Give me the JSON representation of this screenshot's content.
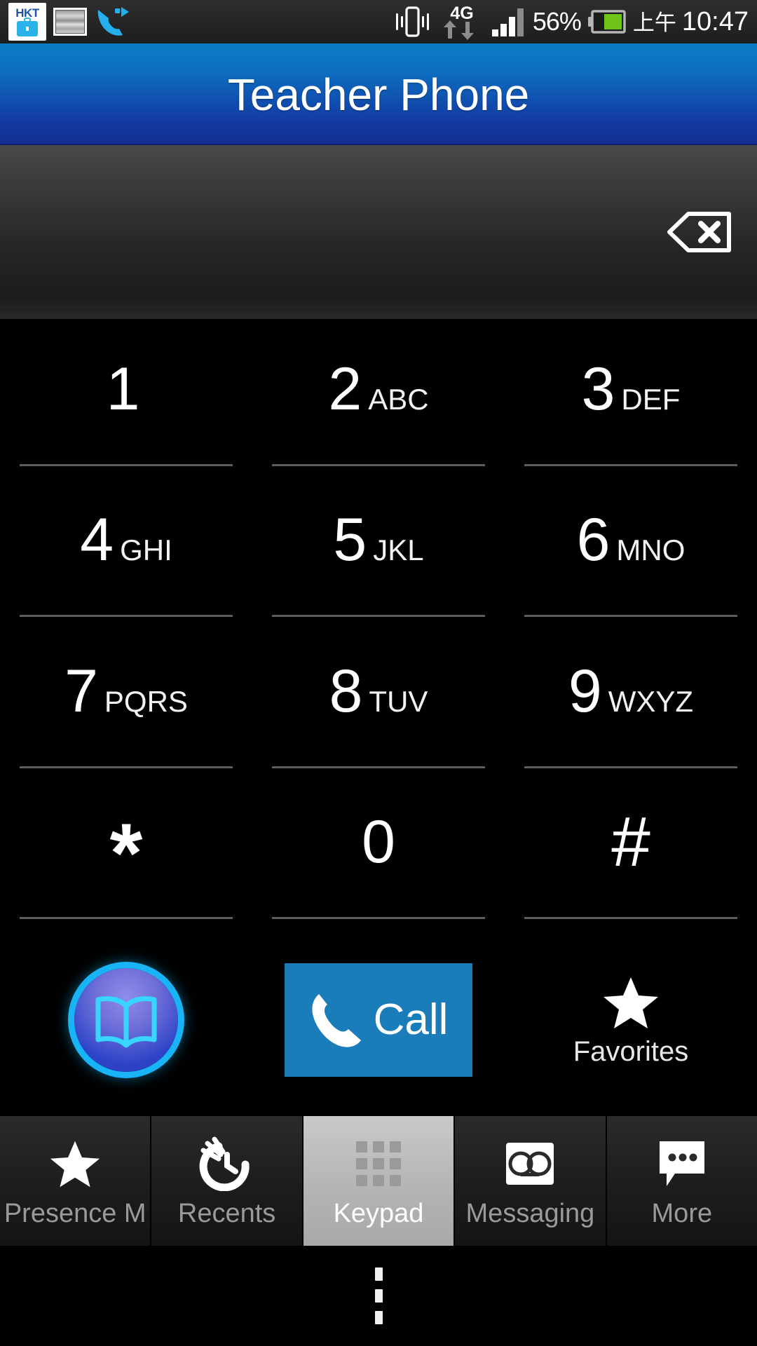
{
  "status_bar": {
    "left_icons": [
      {
        "name": "hkt-briefcase-icon",
        "label": "HKT"
      },
      {
        "name": "picture-icon",
        "label": ""
      },
      {
        "name": "call-forward-icon",
        "label": ""
      }
    ],
    "right_icons": [
      {
        "name": "vibrate-icon",
        "label": ""
      },
      {
        "name": "network-4g-icon",
        "label": "4G"
      },
      {
        "name": "signal-bars-icon",
        "label": ""
      }
    ],
    "battery_percent": "56%",
    "battery_level": 56,
    "clock_ampm": "上午",
    "clock_time": "10:47"
  },
  "header": {
    "title": "Teacher Phone"
  },
  "display": {
    "number": "",
    "placeholder": "",
    "backspace_icon": "backspace-icon"
  },
  "keypad": {
    "keys": [
      {
        "digit": "1",
        "letters": ""
      },
      {
        "digit": "2",
        "letters": "ABC"
      },
      {
        "digit": "3",
        "letters": "DEF"
      },
      {
        "digit": "4",
        "letters": "GHI"
      },
      {
        "digit": "5",
        "letters": "JKL"
      },
      {
        "digit": "6",
        "letters": "MNO"
      },
      {
        "digit": "7",
        "letters": "PQRS"
      },
      {
        "digit": "8",
        "letters": "TUV"
      },
      {
        "digit": "9",
        "letters": "WXYZ"
      },
      {
        "digit": "*",
        "letters": ""
      },
      {
        "digit": "0",
        "letters": ""
      },
      {
        "digit": "#",
        "letters": ""
      }
    ]
  },
  "actions": {
    "directory_icon": "open-book-icon",
    "directory_label": "",
    "call_label": "Call",
    "call_icon": "phone-handset-icon",
    "favorites_label": "Favorites",
    "favorites_icon": "star-icon"
  },
  "tabs": [
    {
      "label": "Presence M",
      "icon": "star-icon",
      "active": false
    },
    {
      "label": "Recents",
      "icon": "recents-swoosh-icon",
      "active": false
    },
    {
      "label": "Keypad",
      "icon": "keypad-grid-icon",
      "active": true
    },
    {
      "label": "Messaging",
      "icon": "voicemail-icon",
      "active": false
    },
    {
      "label": "More",
      "icon": "speech-bubble-icon",
      "active": false
    }
  ],
  "nav": {
    "menu_icon": "overflow-menu-icon"
  },
  "colors": {
    "title_gradient_top": "#0b7cc4",
    "title_gradient_bottom": "#142c8f",
    "call_button": "#1b7cba",
    "accent_cyan": "#19b4f5",
    "battery_green": "#6ec419",
    "keypad_background": "#000000"
  }
}
